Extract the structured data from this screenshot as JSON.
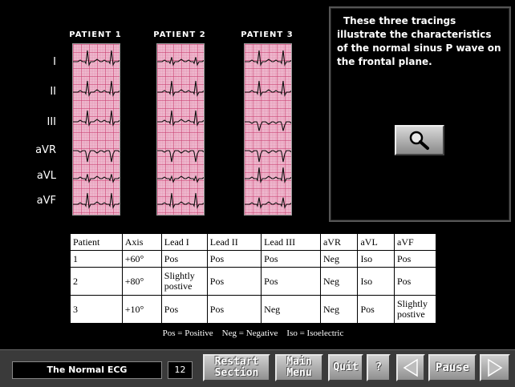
{
  "patients": [
    "PATIENT 1",
    "PATIENT 2",
    "PATIENT 3"
  ],
  "leads": [
    "I",
    "II",
    "III",
    "aVR",
    "aVL",
    "aVF"
  ],
  "panel": {
    "text": "These three tracings illustrate the characteristics of the normal sinus P wave on the frontal plane."
  },
  "table": {
    "headers": [
      "Patient",
      "Axis",
      "Lead I",
      "Lead II",
      "Lead III",
      "aVR",
      "aVL",
      "aVF"
    ],
    "rows": [
      [
        "1",
        "+60°",
        "Pos",
        "Pos",
        "Pos",
        "Neg",
        "Iso",
        "Pos"
      ],
      [
        "2",
        "+80°",
        "Slightly postive",
        "Pos",
        "Pos",
        "Neg",
        "Iso",
        "Pos"
      ],
      [
        "3",
        "+10°",
        "Pos",
        "Pos",
        "Neg",
        "Neg",
        "Pos",
        "Slightly postive"
      ]
    ]
  },
  "legend": "Pos = Positive    Neg = Negative    Iso = Isoelectric",
  "bottom": {
    "title": "The Normal ECG",
    "page": "12",
    "restart_line1": "Restart",
    "restart_line2": "Section",
    "main_line1": "Main",
    "main_line2": "Menu",
    "quit": "Quit",
    "help": "?",
    "pause": "Pause"
  },
  "icons": {
    "zoom": "magnifier-icon",
    "prev": "left-triangle-icon",
    "next": "right-triangle-icon"
  },
  "strip_polarity": [
    [
      1,
      1,
      1,
      -1,
      0.4,
      1
    ],
    [
      0.4,
      1,
      1,
      -1,
      0.2,
      1
    ],
    [
      1,
      1,
      -0.8,
      -1,
      1,
      0.6
    ]
  ]
}
